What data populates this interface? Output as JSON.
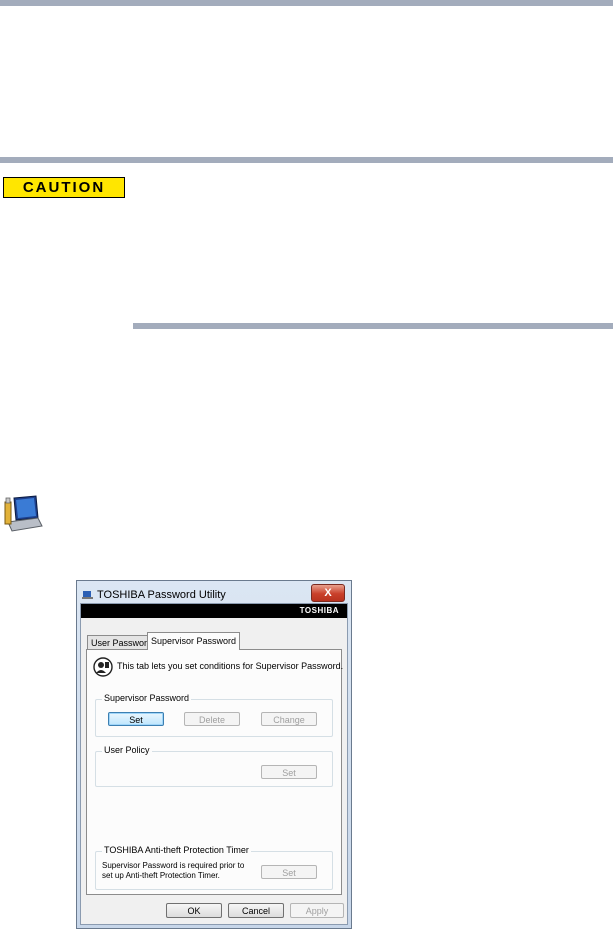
{
  "caution": {
    "label": "CAUTION"
  },
  "dialog": {
    "title": "TOSHIBA Password Utility",
    "close_label": "X",
    "brand": "TOSHIBA",
    "tabs": [
      {
        "label": "User Password",
        "active": false
      },
      {
        "label": "Supervisor Password",
        "active": true
      }
    ],
    "info_text": "This tab lets you set conditions for Supervisor Password.",
    "supervisor_group": {
      "label": "Supervisor Password",
      "set_label": "Set",
      "delete_label": "Delete",
      "change_label": "Change"
    },
    "policy_group": {
      "label": "User Policy",
      "set_label": "Set"
    },
    "antitheft_group": {
      "label": "TOSHIBA Anti-theft Protection Timer",
      "text": "Supervisor Password is required prior to set up Anti-theft Protection Timer.",
      "set_label": "Set"
    },
    "footer": {
      "ok_label": "OK",
      "cancel_label": "Cancel",
      "apply_label": "Apply"
    }
  }
}
